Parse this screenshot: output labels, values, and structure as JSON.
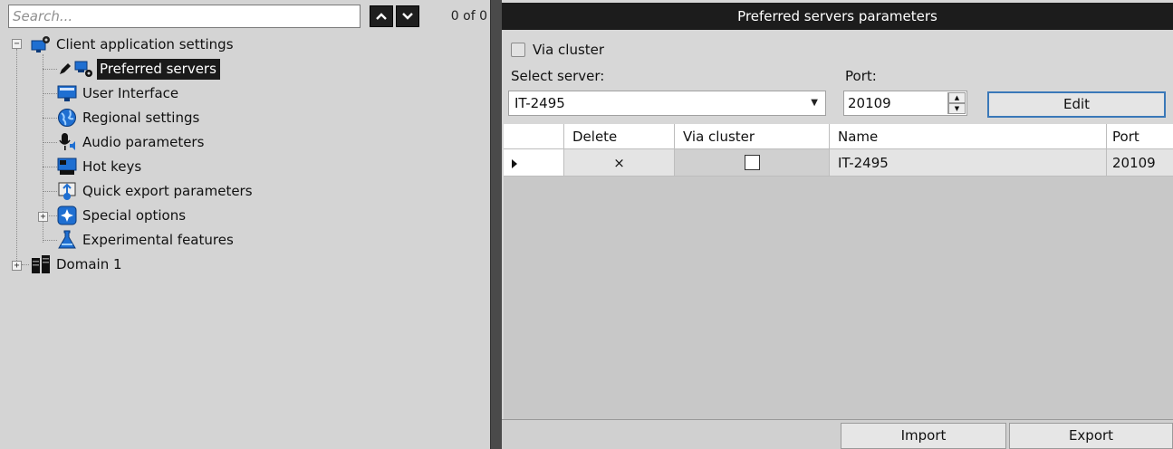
{
  "search": {
    "placeholder": "Search...",
    "counter": "0 of 0"
  },
  "tree": {
    "root": "Client application settings",
    "items": [
      {
        "label": "Preferred servers"
      },
      {
        "label": "User Interface"
      },
      {
        "label": "Regional settings"
      },
      {
        "label": "Audio parameters"
      },
      {
        "label": "Hot keys"
      },
      {
        "label": "Quick export parameters"
      },
      {
        "label": "Special options"
      },
      {
        "label": "Experimental features"
      }
    ],
    "domain": "Domain 1",
    "expand_symbol": "+",
    "collapse_symbol": "−"
  },
  "panel": {
    "title": "Preferred servers parameters",
    "via_cluster_label": "Via cluster",
    "select_server_label": "Select server:",
    "port_label": "Port:",
    "selected_server": "IT-2495",
    "port_value": "20109",
    "edit_label": "Edit"
  },
  "table": {
    "columns": [
      "Delete",
      "Via cluster",
      "Name",
      "Port"
    ],
    "rows": [
      {
        "delete": "×",
        "name": "IT-2495",
        "port": "20109"
      }
    ]
  },
  "footer": {
    "import_label": "Import",
    "export_label": "Export"
  },
  "colors": {
    "selection": "#1a1a1a",
    "header": "#1c1c1c",
    "accent": "#3a78b8"
  }
}
